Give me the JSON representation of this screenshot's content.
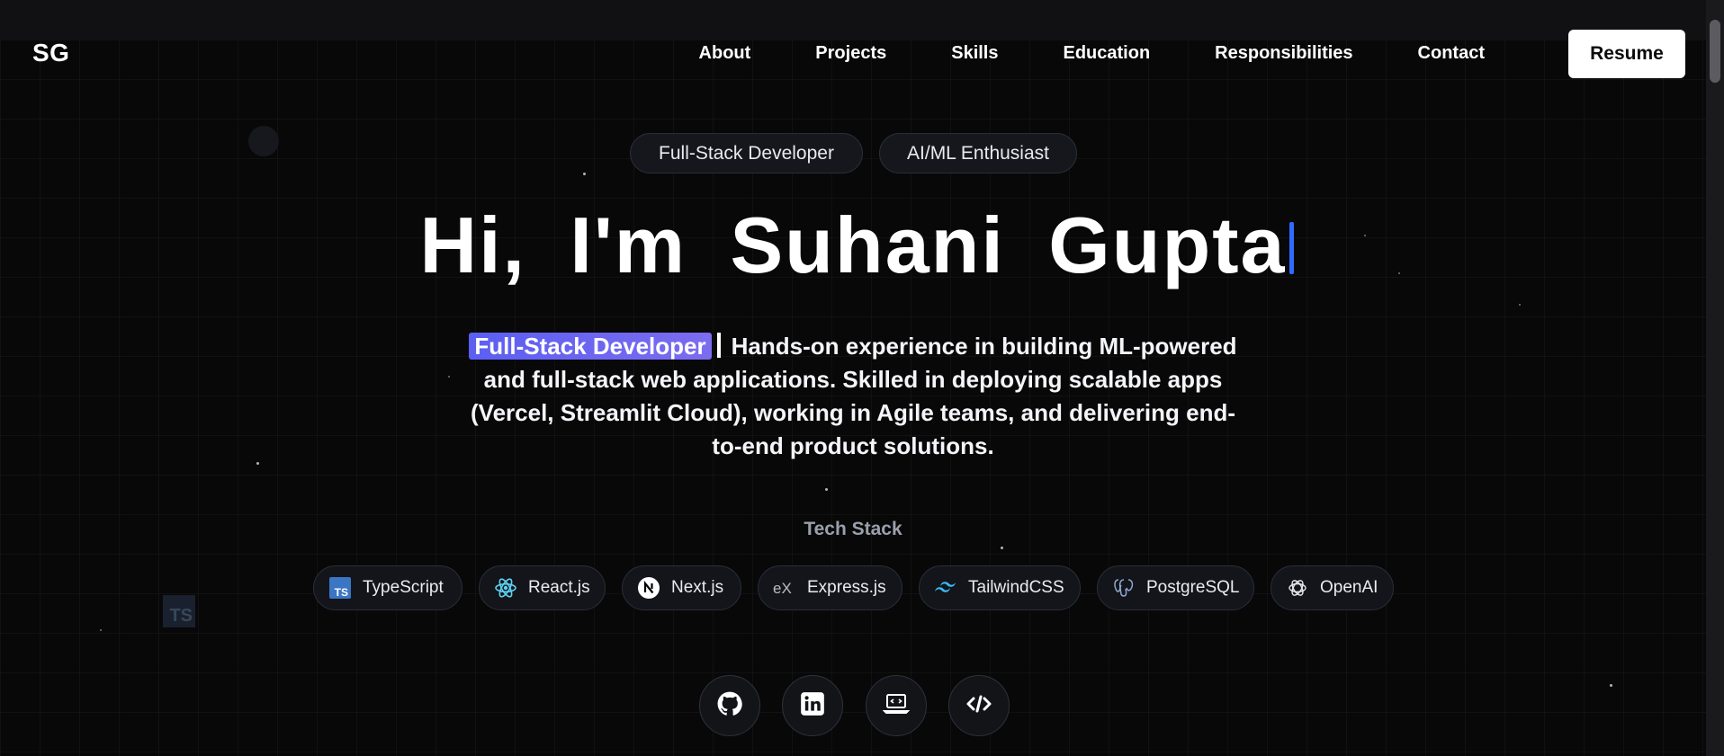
{
  "nav": {
    "logo": "SG",
    "links": [
      "About",
      "Projects",
      "Skills",
      "Education",
      "Responsibilities",
      "Contact"
    ],
    "resume_label": "Resume"
  },
  "hero": {
    "badges": [
      "Full-Stack Developer",
      "AI/ML Enthusiast"
    ],
    "title": "Hi, I'm Suhani Gupta",
    "highlight": "Full-Stack Developer",
    "description": "Hands-on experience in building ML-powered and full-stack web applications. Skilled in deploying scalable apps (Vercel, Streamlit Cloud), working in Agile teams, and delivering end-to-end product solutions."
  },
  "tech_stack": {
    "label": "Tech Stack",
    "items": [
      {
        "label": "TypeScript",
        "icon": "typescript-icon"
      },
      {
        "label": "React.js",
        "icon": "react-icon"
      },
      {
        "label": "Next.js",
        "icon": "nextjs-icon"
      },
      {
        "label": "Express.js",
        "icon": "express-icon"
      },
      {
        "label": "TailwindCSS",
        "icon": "tailwind-icon"
      },
      {
        "label": "PostgreSQL",
        "icon": "postgresql-icon"
      },
      {
        "label": "OpenAI",
        "icon": "openai-icon"
      }
    ]
  },
  "socials": [
    {
      "icon": "github-icon"
    },
    {
      "icon": "linkedin-icon"
    },
    {
      "icon": "laptop-code-icon"
    },
    {
      "icon": "code-icon"
    }
  ],
  "colors": {
    "background": "#080809",
    "accent_blue": "#2f6bff",
    "highlight_purple": "#5b5ff2"
  }
}
